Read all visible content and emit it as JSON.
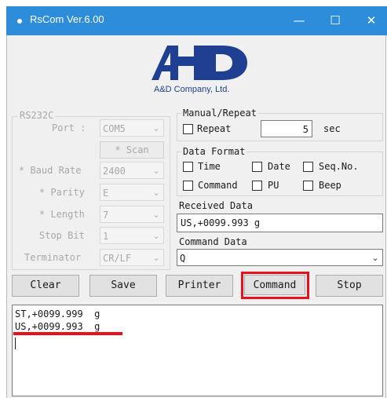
{
  "window": {
    "title": "RsCom Ver.6.00",
    "controls": {
      "minimize": "—",
      "maximize": "☐",
      "close": "✕"
    }
  },
  "logo": {
    "mark": "A&D",
    "caption": "A&D Company, Ltd."
  },
  "rs232c": {
    "title": "RS232C",
    "port_label": "Port :",
    "port_value": "COM5",
    "scan_label": "* Scan",
    "baud_label": "* Baud Rate",
    "baud_value": "2400",
    "parity_label": "* Parity",
    "parity_value": "E",
    "length_label": "* Length",
    "length_value": "7",
    "stopbit_label": "Stop Bit",
    "stopbit_value": "1",
    "terminator_label": "Terminator",
    "terminator_value": "CR/LF",
    "enabled": false
  },
  "manual_repeat": {
    "title": "Manual/Repeat",
    "repeat_label": "Repeat",
    "repeat_checked": false,
    "interval_value": "5",
    "unit_label": "sec"
  },
  "data_format": {
    "title": "Data Format",
    "options": {
      "time": {
        "label": "Time",
        "checked": false
      },
      "date": {
        "label": "Date",
        "checked": false
      },
      "seqno": {
        "label": "Seq.No.",
        "checked": false
      },
      "command": {
        "label": "Command",
        "checked": false
      },
      "pu": {
        "label": "PU",
        "checked": false
      },
      "beep": {
        "label": "Beep",
        "checked": false
      }
    }
  },
  "received_data": {
    "label": "Received Data",
    "value": "US,+0099.993  g"
  },
  "command_data": {
    "label": "Command Data",
    "value": "Q"
  },
  "buttons": {
    "clear": "Clear",
    "save": "Save",
    "printer": "Printer",
    "command": "Command",
    "stop": "Stop"
  },
  "log": {
    "lines": [
      "ST,+0099.999  g",
      "US,+0099.993  g"
    ]
  },
  "colors": {
    "titlebar": "#2e8ddb",
    "highlight": "#e8101c",
    "logo": "#1e3f92"
  }
}
